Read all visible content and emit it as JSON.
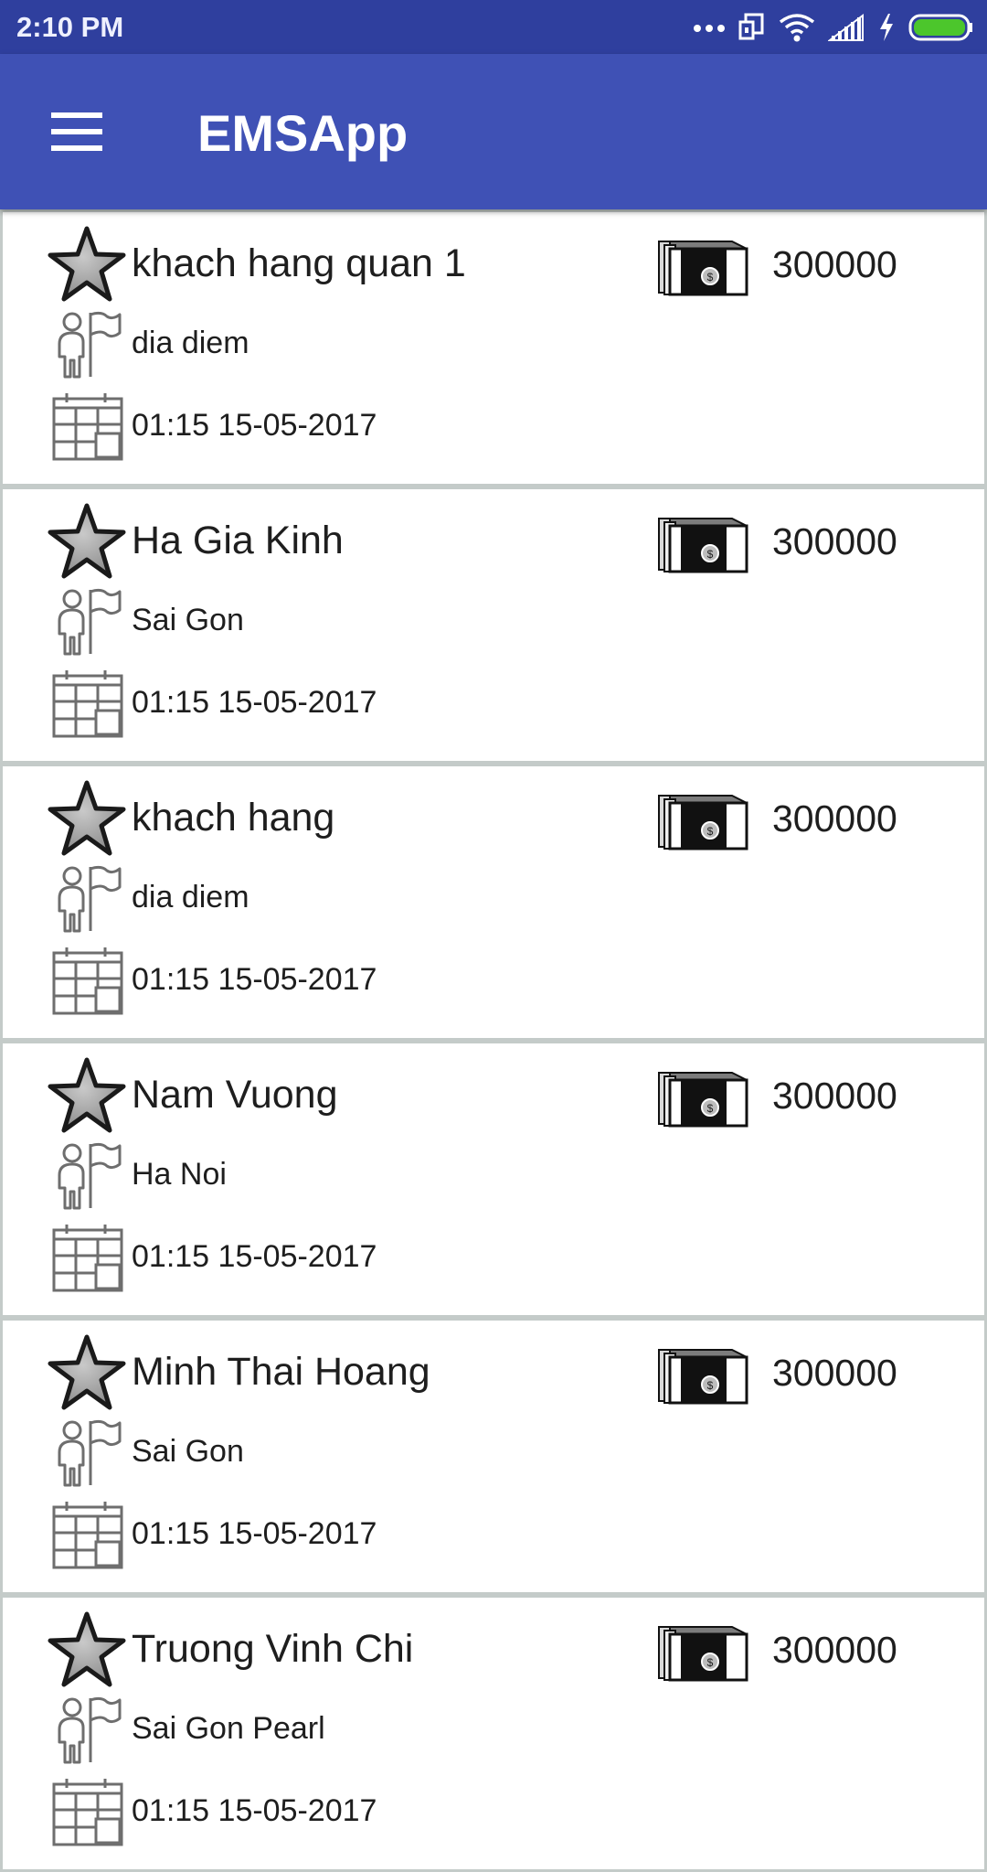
{
  "status_bar": {
    "time": "2:10 PM",
    "icons": [
      "more-dots-icon",
      "screen-cast-icon",
      "wifi-icon",
      "signal-icon",
      "charging-icon",
      "battery-icon"
    ],
    "battery_color": "#4cc62c"
  },
  "app_bar": {
    "title": "EMSApp",
    "menu_icon": "hamburger-menu-icon",
    "color": "#3f51b5"
  },
  "items": [
    {
      "name": "khach hang quan 1",
      "amount": "300000",
      "location": "dia diem",
      "datetime": "01:15 15-05-2017"
    },
    {
      "name": "Ha Gia Kinh",
      "amount": "300000",
      "location": "Sai Gon",
      "datetime": "01:15 15-05-2017"
    },
    {
      "name": "khach hang",
      "amount": "300000",
      "location": "dia diem",
      "datetime": "01:15 15-05-2017"
    },
    {
      "name": "Nam Vuong",
      "amount": "300000",
      "location": "Ha Noi",
      "datetime": "01:15 15-05-2017"
    },
    {
      "name": "Minh Thai Hoang",
      "amount": "300000",
      "location": "Sai Gon",
      "datetime": "01:15 15-05-2017"
    },
    {
      "name": "Truong Vinh Chi",
      "amount": "300000",
      "location": "Sai Gon Pearl",
      "datetime": "01:15 15-05-2017"
    }
  ],
  "item_icons": {
    "favorite": "star-icon",
    "money": "cash-stack-icon",
    "location": "person-flag-icon",
    "date": "calendar-icon"
  }
}
